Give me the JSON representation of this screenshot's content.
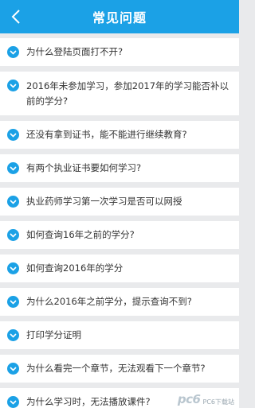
{
  "header": {
    "title": "常见问题",
    "back_icon": "chevron-left-icon"
  },
  "faq": [
    {
      "question": "为什么登陆页面打不开?"
    },
    {
      "question": "2016年未参加学习，参加2017年的学习能否补以前的学分?"
    },
    {
      "question": "还没有拿到证书，能不能进行继续教育?"
    },
    {
      "question": "有两个执业证书要如何学习?"
    },
    {
      "question": "执业药师学习第一次学习是否可以网授"
    },
    {
      "question": "如何查询16年之前的学分?"
    },
    {
      "question": "如何查询2016年的学分"
    },
    {
      "question": "为什么2016年之前学分，提示查询不到?"
    },
    {
      "question": "打印学分证明"
    },
    {
      "question": "为什么看完一个章节，无法观看下一个章节?"
    },
    {
      "question": "为什么学习时，无法播放课件?"
    }
  ],
  "watermark": {
    "logo": "pc6",
    "text": "PC6下载站"
  },
  "colors": {
    "accent": "#1ba1e6",
    "background": "#e9eaec",
    "text": "#333333"
  }
}
